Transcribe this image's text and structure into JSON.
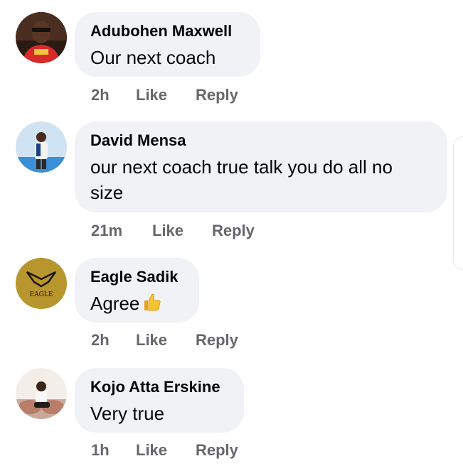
{
  "comments": [
    {
      "author": "Adubohen Maxwell",
      "text": "Our next coach",
      "time": "2h",
      "like": "Like",
      "reply": "Reply"
    },
    {
      "author": "David Mensa",
      "text_line1": "our next coach true talk you do all no",
      "text_line2": "size",
      "time": "21m",
      "like": "Like",
      "reply": "Reply"
    },
    {
      "author": "Eagle Sadik",
      "text": "Agree",
      "emoji": "thumbs-up",
      "avatar_text": "EAGLE",
      "time": "2h",
      "like": "Like",
      "reply": "Reply"
    },
    {
      "author": "Kojo Atta Erskine",
      "text": "Very true",
      "time": "1h",
      "like": "Like",
      "reply": "Reply"
    }
  ],
  "colors": {
    "bubble": "#f0f2f5",
    "name": "#050505",
    "meta": "#65676b",
    "eagle_gold": "#b8962e"
  }
}
